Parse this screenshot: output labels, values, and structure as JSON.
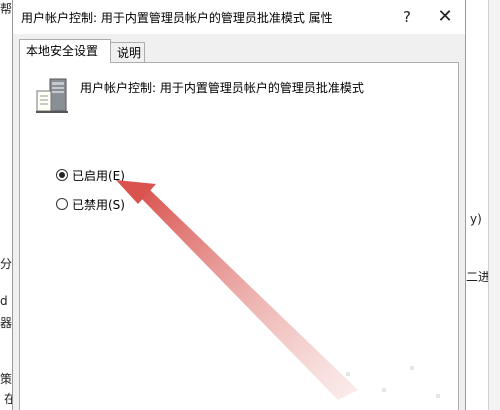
{
  "dialog": {
    "title": "用户帐户控制: 用于内置管理员帐户的管理员批准模式 属性",
    "help_label": "?",
    "close_label": "✕"
  },
  "tabs": [
    {
      "label": "本地安全设置",
      "active": true
    },
    {
      "label": "说明",
      "active": false
    }
  ],
  "policy": {
    "icon": "server-policy-icon",
    "name": "用户帐户控制: 用于内置管理员帐户的管理员批准模式"
  },
  "options": [
    {
      "label": "已启用(E)",
      "checked": true
    },
    {
      "label": "已禁用(S)",
      "checked": false
    }
  ],
  "background": {
    "frag_1": "帮",
    "frag_2": "y)",
    "frag_3": "分",
    "frag_4": "二进制",
    "frag_5": "d",
    "frag_6": "器",
    "frag_7": "策",
    "frag_8": "在"
  },
  "annotation": {
    "arrow_color": "#d9534f"
  }
}
